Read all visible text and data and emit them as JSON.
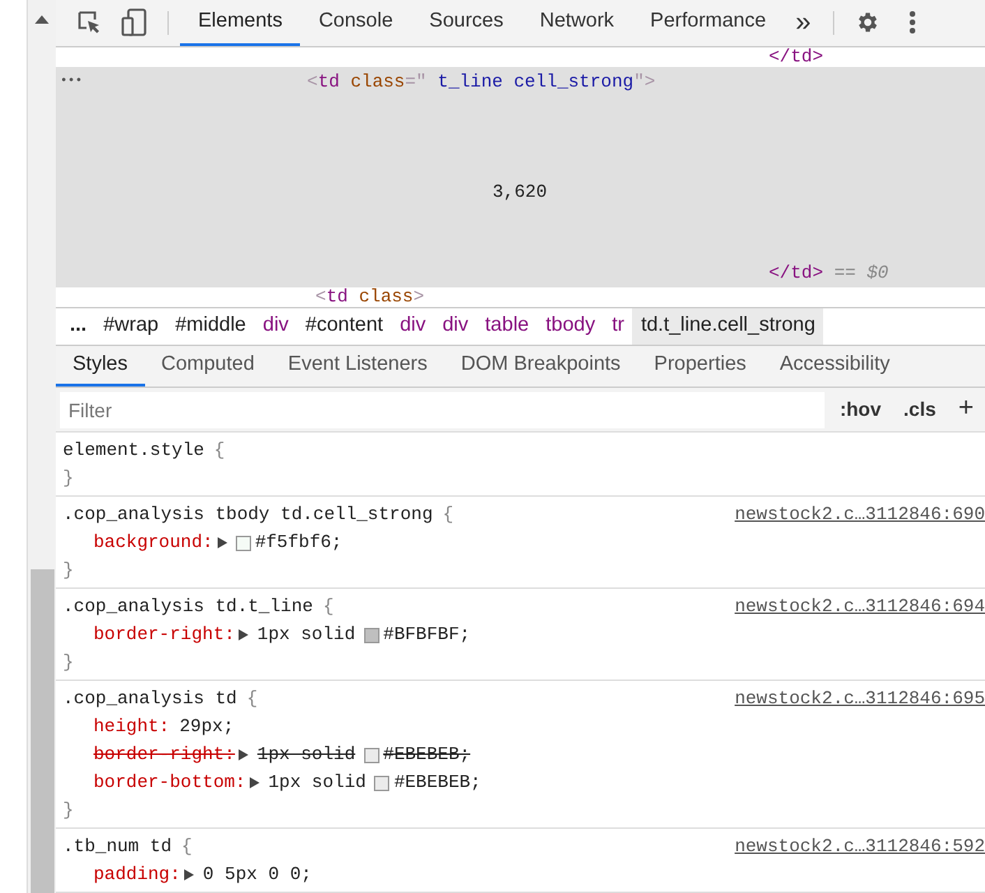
{
  "toolbar": {
    "tabs": [
      {
        "label": "Elements",
        "selected": true
      },
      {
        "label": "Console",
        "selected": false
      },
      {
        "label": "Sources",
        "selected": false
      },
      {
        "label": "Network",
        "selected": false
      },
      {
        "label": "Performance",
        "selected": false
      }
    ],
    "overflow": "»"
  },
  "dom": {
    "ellipsis": "•••",
    "lines": [
      {
        "kind": "close",
        "selected": false,
        "tokens": [
          {
            "kind": "tag",
            "text": "</td>"
          }
        ]
      },
      {
        "kind": "open",
        "selected": true,
        "tokens": [
          {
            "kind": "bracket",
            "text": "<"
          },
          {
            "kind": "tag",
            "text": "td"
          },
          {
            "kind": "attr",
            "text": " class"
          },
          {
            "kind": "bracket",
            "text": "=\""
          },
          {
            "kind": "value",
            "text": " t_line cell_strong"
          },
          {
            "kind": "bracket",
            "text": "\">"
          }
        ]
      },
      {
        "kind": "content",
        "selected": true,
        "tokens": [
          {
            "kind": "text",
            "text": "3,620"
          }
        ]
      },
      {
        "kind": "close",
        "selected": true,
        "tokens": [
          {
            "kind": "tag",
            "text": "</td>"
          },
          {
            "kind": "marker",
            "text": " == "
          },
          {
            "kind": "var",
            "text": "$0"
          }
        ]
      },
      {
        "kind": "open",
        "selected": false,
        "tokens": [
          {
            "kind": "bracket",
            "text": "<"
          },
          {
            "kind": "tag",
            "text": "td"
          },
          {
            "kind": "attr",
            "text": " class"
          },
          {
            "kind": "bracket",
            "text": ">"
          }
        ]
      }
    ]
  },
  "breadcrumbs": [
    {
      "kind": "more",
      "text": "...",
      "selected": false
    },
    {
      "kind": "id",
      "text": "#wrap",
      "selected": false
    },
    {
      "kind": "id",
      "text": "#middle",
      "selected": false
    },
    {
      "kind": "tag",
      "text": "div",
      "selected": false
    },
    {
      "kind": "id",
      "text": "#content",
      "selected": false
    },
    {
      "kind": "tag",
      "text": "div",
      "selected": false
    },
    {
      "kind": "tag",
      "text": "div",
      "selected": false
    },
    {
      "kind": "tag",
      "text": "table",
      "selected": false
    },
    {
      "kind": "tag",
      "text": "tbody",
      "selected": false
    },
    {
      "kind": "tag",
      "text": "tr",
      "selected": false
    },
    {
      "kind": "id",
      "text": "td.t_line.cell_strong",
      "selected": true
    }
  ],
  "styles_tabs": [
    {
      "label": "Styles",
      "selected": true
    },
    {
      "label": "Computed",
      "selected": false
    },
    {
      "label": "Event Listeners",
      "selected": false
    },
    {
      "label": "DOM Breakpoints",
      "selected": false
    },
    {
      "label": "Properties",
      "selected": false
    },
    {
      "label": "Accessibility",
      "selected": false
    }
  ],
  "filter": {
    "placeholder": "Filter",
    "buttons": [
      ":hov",
      ".cls",
      "+"
    ]
  },
  "rules": [
    {
      "selector": "element.style",
      "open_brace": "{",
      "close_brace": "}"
    },
    {
      "selector": ".cop_analysis tbody td.cell_strong",
      "open_brace": "{",
      "close_brace": "}",
      "source": "newstock2.c…3112846:690",
      "declarations": [
        {
          "property": "background:",
          "expandable": true,
          "overridden": false,
          "color": "#f5fbf6",
          "value": "#f5fbf6;"
        }
      ]
    },
    {
      "selector": ".cop_analysis td.t_line",
      "open_brace": "{",
      "close_brace": "}",
      "source": "newstock2.c…3112846:694",
      "declarations": [
        {
          "property": "border-right:",
          "expandable": true,
          "overridden": false,
          "prefix": "1px solid",
          "color": "#bfbfbf",
          "value": "#BFBFBF;"
        }
      ]
    },
    {
      "selector": ".cop_analysis td",
      "open_brace": "{",
      "close_brace": "}",
      "source": "newstock2.c…3112846:695",
      "declarations": [
        {
          "property": "height:",
          "expandable": false,
          "overridden": false,
          "value": "29px;"
        },
        {
          "property": "border-right:",
          "expandable": true,
          "overridden": true,
          "prefix": "1px solid",
          "color": "#ebebeb",
          "value": "#EBEBEB;"
        },
        {
          "property": "border-bottom:",
          "expandable": true,
          "overridden": false,
          "prefix": "1px solid",
          "color": "#ebebeb",
          "value": "#EBEBEB;"
        }
      ]
    },
    {
      "selector": ".tb_num td",
      "open_brace": "{",
      "source": "newstock2.c…3112846:592",
      "declarations": [
        {
          "property": "padding:",
          "expandable": true,
          "overridden": false,
          "value": "0 5px 0 0;"
        }
      ]
    }
  ]
}
